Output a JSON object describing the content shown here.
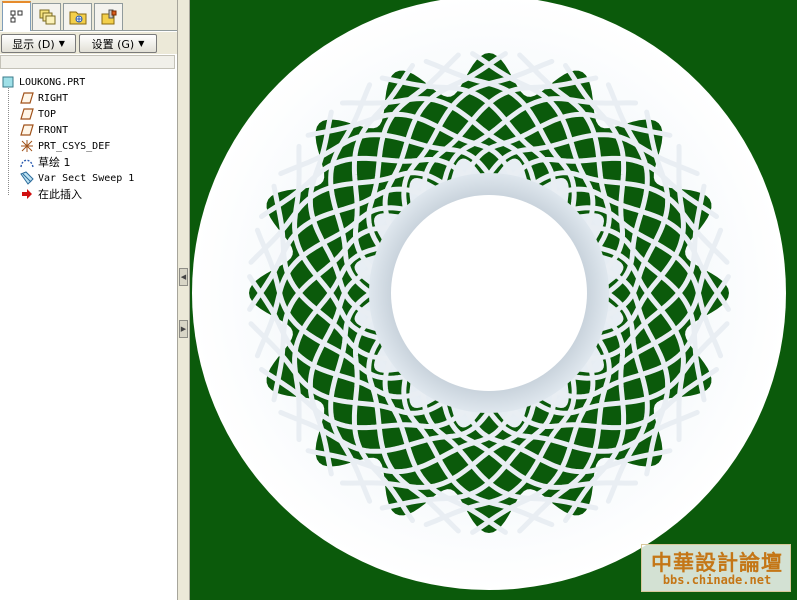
{
  "tabs": [
    {
      "name": "model-tree-icon",
      "active": true
    },
    {
      "name": "layers-icon",
      "active": false
    },
    {
      "name": "folder-browser-icon",
      "active": false
    },
    {
      "name": "favorites-icon",
      "active": false
    }
  ],
  "toolbar": {
    "show_label": "显示 (D)",
    "settings_label": "设置 (G)"
  },
  "model_tree": {
    "root": {
      "label": "LOUKONG.PRT",
      "icon": "part-icon"
    },
    "items": [
      {
        "label": "RIGHT",
        "icon": "datum-plane-icon"
      },
      {
        "label": "TOP",
        "icon": "datum-plane-icon"
      },
      {
        "label": "FRONT",
        "icon": "datum-plane-icon"
      },
      {
        "label": "PRT_CSYS_DEF",
        "icon": "coordinate-system-icon"
      },
      {
        "label": "草绘 1",
        "icon": "sketch-icon"
      },
      {
        "label": "Var Sect Sweep 1",
        "icon": "var-sect-sweep-icon"
      },
      {
        "label": "在此插入",
        "icon": "insert-here-arrow-icon"
      }
    ]
  },
  "watermark": {
    "title": "中華設計論壇",
    "url": "bbs.chinade.net"
  },
  "colors": {
    "graphics_background": "#0b5a0b",
    "panel_background": "#ece9d8",
    "model_surface": "#f2f6fa",
    "watermark_text": "#c47616",
    "insert_arrow": "#d01010"
  }
}
